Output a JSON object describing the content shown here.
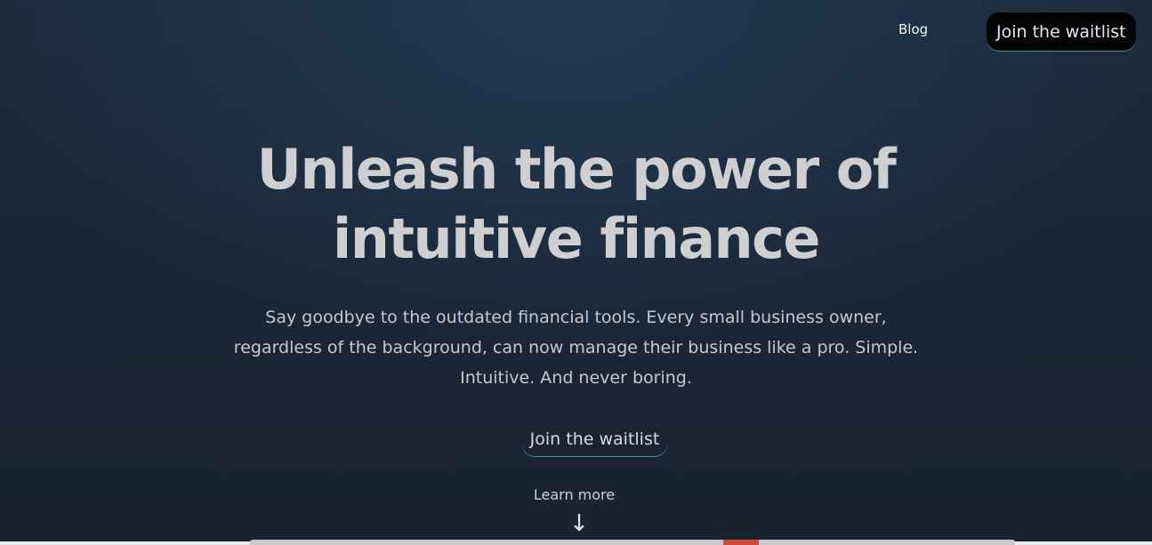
{
  "nav": {
    "blog_label": "Blog",
    "cta_label": "Join the waitlist"
  },
  "hero": {
    "title": "Unleash the power of intuitive finance",
    "subtitle": "Say goodbye to the outdated financial tools. Every small business owner, regardless of the background, can now manage their business like a pro. Simple. Intuitive. And never boring.",
    "cta_label": "Join the waitlist"
  },
  "learn_more": {
    "label": "Learn more",
    "arrow": "↓"
  },
  "colors": {
    "background": "#1c2a3b",
    "accent_border": "#3d8ea0",
    "nav_button_bg": "#020305",
    "heading_text": "#cfcfd2"
  }
}
